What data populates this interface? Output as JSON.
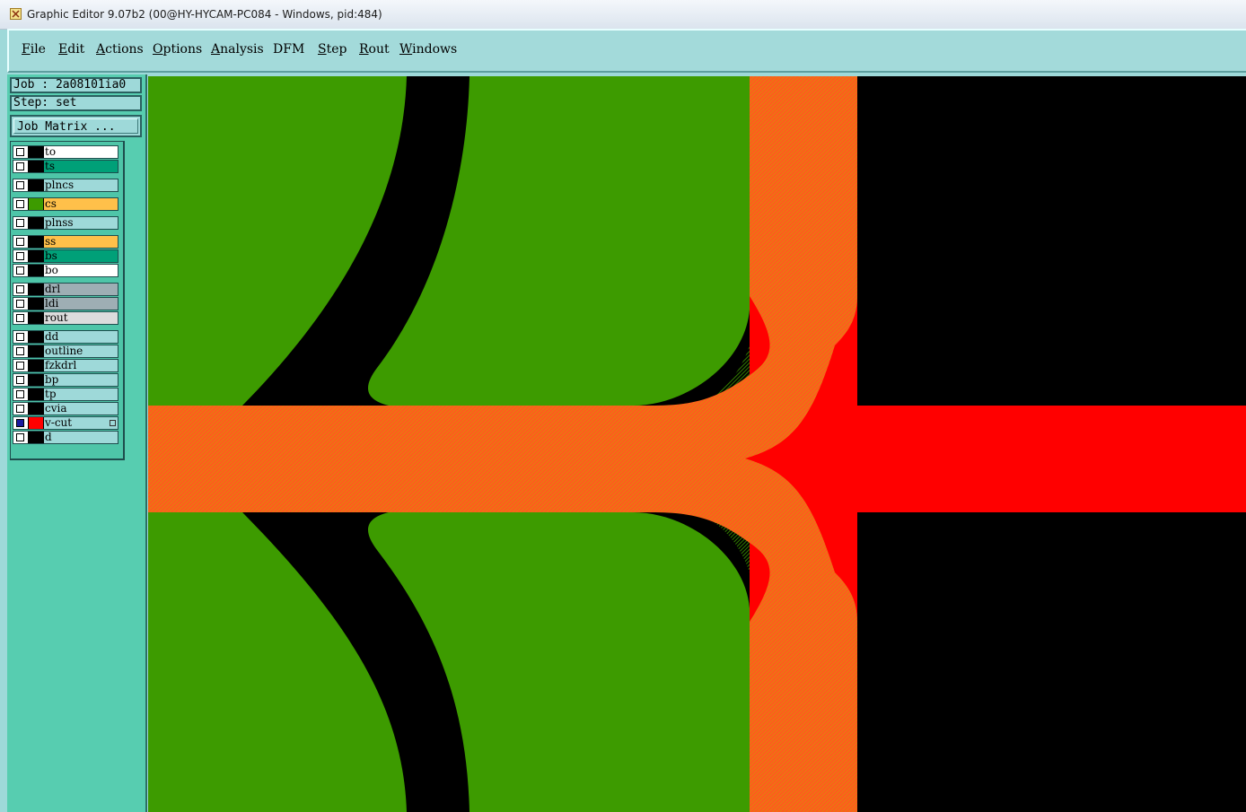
{
  "window": {
    "title": "Graphic Editor 9.07b2 (00@HY-HYCAM-PC084 - Windows, pid:484)"
  },
  "menu": [
    {
      "mnemonic": "F",
      "rest": "ile"
    },
    {
      "mnemonic": "E",
      "rest": "dit"
    },
    {
      "mnemonic": "A",
      "rest": "ctions"
    },
    {
      "mnemonic": "O",
      "rest": "ptions"
    },
    {
      "mnemonic": "A",
      "rest": "nalysis"
    },
    {
      "mnemonic": "",
      "rest": "DFM"
    },
    {
      "mnemonic": "S",
      "rest": "tep"
    },
    {
      "mnemonic": "R",
      "rest": "out"
    },
    {
      "mnemonic": "W",
      "rest": "indows"
    }
  ],
  "panel": {
    "job": "Job : 2a08101ia0",
    "step": "Step: set",
    "job_matrix_label": "Job Matrix ..."
  },
  "layers": [
    {
      "name": "to",
      "bg": "#ffffff",
      "swatch": "#000000",
      "checked": false
    },
    {
      "name": "ts",
      "bg": "#00a078",
      "swatch": "#000000",
      "checked": false
    },
    {
      "name": "plncs",
      "bg": "#9ed9d9",
      "swatch": "#000000",
      "checked": false
    },
    {
      "name": "cs",
      "bg": "#ffc04a",
      "swatch": "#3d9b00",
      "checked": false
    },
    {
      "name": "plnss",
      "bg": "#9ed9d9",
      "swatch": "#000000",
      "checked": false
    },
    {
      "name": "ss",
      "bg": "#ffc04a",
      "swatch": "#000000",
      "checked": false
    },
    {
      "name": "bs",
      "bg": "#00a078",
      "swatch": "#000000",
      "checked": false
    },
    {
      "name": "bo",
      "bg": "#ffffff",
      "swatch": "#000000",
      "checked": false
    },
    {
      "name": "drl",
      "bg": "#9eaeb4",
      "swatch": "#000000",
      "checked": false
    },
    {
      "name": "ldi",
      "bg": "#9eaeb4",
      "swatch": "#000000",
      "checked": false
    },
    {
      "name": "rout",
      "bg": "#dcdcdc",
      "swatch": "#000000",
      "checked": false
    },
    {
      "name": "dd",
      "bg": "#9ed9d9",
      "swatch": "#000000",
      "checked": false
    },
    {
      "name": "outline",
      "bg": "#9ed9d9",
      "swatch": "#000000",
      "checked": false
    },
    {
      "name": "fzkdrl",
      "bg": "#9ed9d9",
      "swatch": "#000000",
      "checked": false
    },
    {
      "name": "bp",
      "bg": "#9ed9d9",
      "swatch": "#000000",
      "checked": false
    },
    {
      "name": "tp",
      "bg": "#9ed9d9",
      "swatch": "#000000",
      "checked": false
    },
    {
      "name": "cvia",
      "bg": "#9ed9d9",
      "swatch": "#000000",
      "checked": false
    },
    {
      "name": "v-cut",
      "bg": "#9ed9d9",
      "swatch": "#ff0000",
      "checked": true,
      "marker": true
    },
    {
      "name": "d",
      "bg": "#9ed9d9",
      "swatch": "#000000",
      "checked": false
    }
  ],
  "colors": {
    "copper_green": "#3d9b00",
    "route_orange": "#ff5a1e",
    "vcut_red": "#ff0000",
    "background": "#000000"
  }
}
